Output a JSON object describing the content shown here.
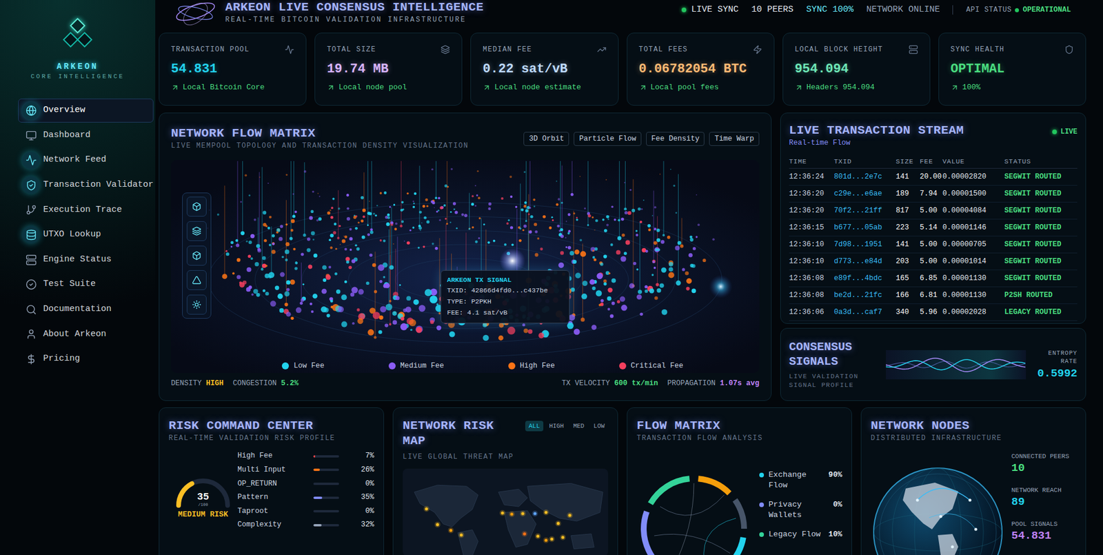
{
  "sidebar": {
    "brand": "ARKEON",
    "tagline": "CORE INTELLIGENCE",
    "items": [
      {
        "label": "Overview",
        "selected": true,
        "glow": true
      },
      {
        "label": "Dashboard",
        "selected": false,
        "glow": false
      },
      {
        "label": "Network Feed",
        "selected": false,
        "glow": true
      },
      {
        "label": "Transaction Validator",
        "selected": false,
        "glow": true
      },
      {
        "label": "Execution Trace",
        "selected": false,
        "glow": false
      },
      {
        "label": "UTXO Lookup",
        "selected": false,
        "glow": true
      },
      {
        "label": "Engine Status",
        "selected": false,
        "glow": false
      },
      {
        "label": "Test Suite",
        "selected": false,
        "glow": false
      },
      {
        "label": "Documentation",
        "selected": false,
        "glow": false
      },
      {
        "label": "About Arkeon",
        "selected": false,
        "glow": false
      },
      {
        "label": "Pricing",
        "selected": false,
        "glow": false
      }
    ]
  },
  "header": {
    "title": "ARKEON LIVE CONSENSUS INTELLIGENCE",
    "subtitle": "REAL-TIME BITCOIN VALIDATION INFRASTRUCTURE",
    "indicators": [
      {
        "text": "LIVE SYNC",
        "dot": true,
        "color": "#e2e8f0"
      },
      {
        "text": "10 PEERS",
        "dot": false,
        "color": "#e2e8f0"
      },
      {
        "text": "SYNC 100%",
        "dot": false,
        "color": "#67e8f9"
      },
      {
        "text": "NETWORK ONLINE",
        "dot": false,
        "color": "#94a3b8"
      }
    ],
    "api": {
      "label": "API STATUS",
      "value": "OPERATIONAL"
    }
  },
  "stats": [
    {
      "label": "TRANSACTION POOL",
      "value": "54.831",
      "sub": "Local Bitcoin Core",
      "color": "#22d3ee"
    },
    {
      "label": "TOTAL SIZE",
      "value": "19.74 MB",
      "sub": "Local node pool",
      "color": "#d8b4fe"
    },
    {
      "label": "MEDIAN FEE",
      "value": "0.22 sat/vB",
      "sub": "Local node estimate",
      "color": "#bfdbfe"
    },
    {
      "label": "TOTAL FEES",
      "value": "0.06782054 BTC",
      "sub": "Local pool fees",
      "color": "#fdba74"
    },
    {
      "label": "LOCAL BLOCK HEIGHT",
      "value": "954.094",
      "sub": "Headers 954.094",
      "color": "#6ee7b7"
    },
    {
      "label": "SYNC HEALTH",
      "value": "OPTIMAL",
      "sub": "100%",
      "color": "#4ade80"
    }
  ],
  "flow": {
    "title": "NETWORK FLOW MATRIX",
    "subtitle": "LIVE MEMPOOL TOPOLOGY AND TRANSACTION DENSITY VISUALIZATION",
    "modes": [
      {
        "label": "3D Orbit",
        "selected": false
      },
      {
        "label": "Particle Flow",
        "selected": false
      },
      {
        "label": "Fee Density",
        "selected": false
      },
      {
        "label": "Time Warp",
        "selected": false
      }
    ],
    "tooltip": {
      "title": "ARKEON TX SIGNAL",
      "lines": [
        "TXID: 42866d4fd0...c437be",
        "TYPE: P2PKH",
        "FEE: 4.1 sat/vB"
      ]
    },
    "legend": [
      {
        "label": "Low Fee",
        "color": "#22d3ee"
      },
      {
        "label": "Medium Fee",
        "color": "#8b5cf6"
      },
      {
        "label": "High Fee",
        "color": "#f97316"
      },
      {
        "label": "Critical Fee",
        "color": "#f43f5e"
      }
    ],
    "footer_left": [
      {
        "label": "DENSITY",
        "value": "HIGH",
        "color": "#fbbf24"
      },
      {
        "label": "CONGESTION",
        "value": "5.2%",
        "color": "#4ade80"
      }
    ],
    "footer_right": [
      {
        "label": "TX VELOCITY",
        "value": "600 tx/min",
        "color": "#4ade80"
      },
      {
        "label": "PROPAGATION",
        "value": "1.07s avg",
        "color": "#c084fc"
      }
    ]
  },
  "stream": {
    "title": "LIVE TRANSACTION STREAM",
    "subtitle": "Real-time Flow",
    "badge": "LIVE",
    "columns": [
      "TIME",
      "TXID",
      "SIZE",
      "FEE",
      "VALUE",
      "STATUS"
    ],
    "rows": [
      [
        "12:36:24",
        "801d...2e7c",
        "141",
        "20.00",
        "0.00002820",
        "SEGWIT ROUTED"
      ],
      [
        "12:36:20",
        "c29e...e6ae",
        "189",
        "7.94",
        "0.00001500",
        "SEGWIT ROUTED"
      ],
      [
        "12:36:20",
        "70f2...21ff",
        "817",
        "5.00",
        "0.00004084",
        "SEGWIT ROUTED"
      ],
      [
        "12:36:15",
        "b677...05ab",
        "223",
        "5.14",
        "0.00001146",
        "SEGWIT ROUTED"
      ],
      [
        "12:36:10",
        "7d98...1951",
        "141",
        "5.00",
        "0.00000705",
        "SEGWIT ROUTED"
      ],
      [
        "12:36:10",
        "d773...e84d",
        "203",
        "5.00",
        "0.00001014",
        "SEGWIT ROUTED"
      ],
      [
        "12:36:08",
        "e89f...4bdc",
        "165",
        "6.85",
        "0.00001130",
        "SEGWIT ROUTED"
      ],
      [
        "12:36:08",
        "be2d...21fc",
        "166",
        "6.81",
        "0.00001130",
        "P2SH ROUTED"
      ],
      [
        "12:36:06",
        "0a3d...caf7",
        "340",
        "5.96",
        "0.00002028",
        "LEGACY ROUTED"
      ]
    ]
  },
  "consensus": {
    "title": "CONSENSUS SIGNALS",
    "subtitle": "LIVE VALIDATION SIGNAL PROFILE",
    "metric_label": "ENTROPY RATE",
    "metric_value": "0.5992"
  },
  "risk": {
    "title": "RISK COMMAND CENTER",
    "subtitle": "REAL-TIME VALIDATION RISK PROFILE",
    "score": "35",
    "scale": "/100",
    "level": 0.35,
    "rating": "MEDIUM RISK",
    "factors": [
      {
        "label": "High Fee",
        "value": "7%",
        "level": 0.07,
        "color": "#ef4444"
      },
      {
        "label": "Multi Input",
        "value": "26%",
        "level": 0.26,
        "color": "#f97316"
      },
      {
        "label": "OP_RETURN",
        "value": "0%",
        "level": 0,
        "color": "#64748b"
      },
      {
        "label": "Pattern",
        "value": "35%",
        "level": 0.35,
        "color": "#818cf8"
      },
      {
        "label": "Taproot",
        "value": "0%",
        "level": 0,
        "color": "#64748b"
      },
      {
        "label": "Complexity",
        "value": "32%",
        "level": 0.32,
        "color": "#94a3b8"
      }
    ]
  },
  "risk_map": {
    "title": "NETWORK RISK MAP",
    "subtitle": "LIVE GLOBAL THREAT MAP",
    "filters": [
      {
        "label": "ALL",
        "selected": true
      },
      {
        "label": "HIGH",
        "selected": false
      },
      {
        "label": "MED",
        "selected": false
      },
      {
        "label": "LOW",
        "selected": false
      }
    ]
  },
  "flow_matrix": {
    "title": "FLOW MATRIX",
    "subtitle": "TRANSACTION FLOW ANALYSIS",
    "legend": [
      {
        "label": "Exchange Flow",
        "value": "90%",
        "color": "#22d3ee"
      },
      {
        "label": "Privacy Wallets",
        "value": "0%",
        "color": "#818cf8"
      },
      {
        "label": "Legacy Flow",
        "value": "10%",
        "color": "#34d399"
      }
    ]
  },
  "nodes": {
    "title": "NETWORK NODES",
    "subtitle": "DISTRIBUTED INFRASTRUCTURE",
    "stats": [
      {
        "label": "CONNECTED PEERS",
        "value": "10",
        "color": "#4ade80"
      },
      {
        "label": "NETWORK REACH",
        "value": "89",
        "color": "#22d3ee"
      },
      {
        "label": "POOL SIGNALS",
        "value": "54.831",
        "color": "#c084fc"
      }
    ]
  }
}
